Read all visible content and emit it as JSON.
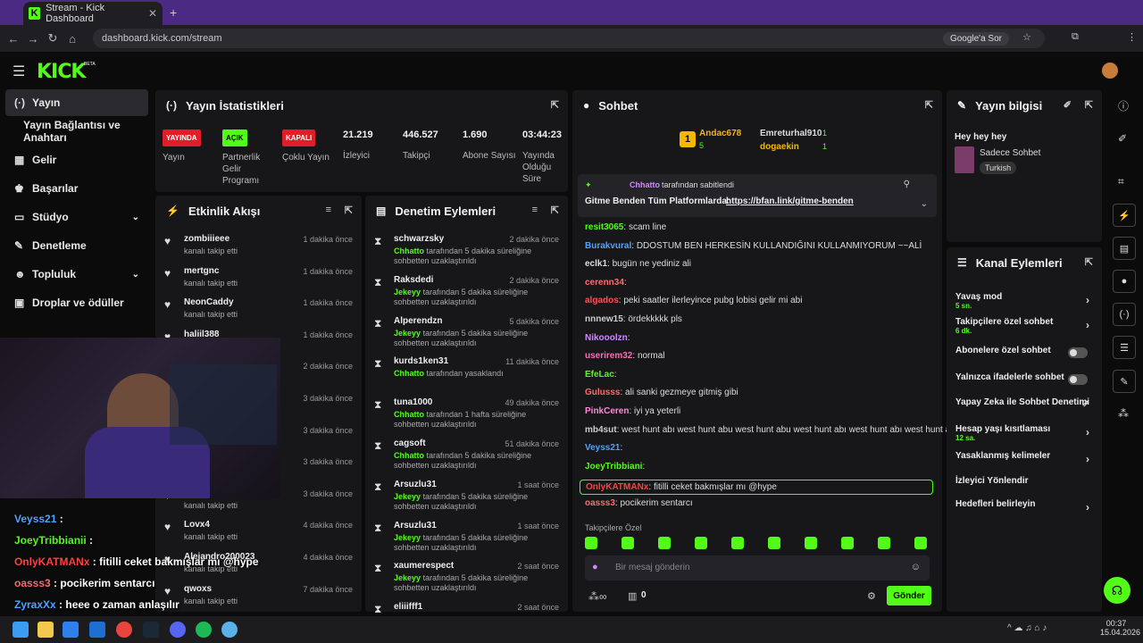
{
  "browser": {
    "tab_title": "Stream - Kick Dashboard",
    "url": "dashboard.kick.com/stream",
    "google_btn": "Google'a Sor"
  },
  "app": {
    "logo": "KICK",
    "beta": "BETA"
  },
  "sidebar": {
    "items": [
      {
        "label": "Yayın",
        "icon": "broadcast-icon"
      },
      {
        "label": "Yayın Bağlantısı ve Anahtarı"
      },
      {
        "label": "Gelir",
        "icon": "revenue-icon"
      },
      {
        "label": "Başarılar",
        "icon": "trophy-icon"
      },
      {
        "label": "Stüdyo",
        "icon": "studio-icon"
      },
      {
        "label": "Denetleme",
        "icon": "wrench-icon"
      },
      {
        "label": "Topluluk",
        "icon": "community-icon"
      },
      {
        "label": "Droplar ve ödüller",
        "icon": "gift-icon"
      }
    ]
  },
  "stats": {
    "title": "Yayın İstatistikleri",
    "items": [
      {
        "badge": "YAYINDA",
        "label": "Yayın",
        "color": "#e11d2a"
      },
      {
        "badge": "AÇIK",
        "label": "Partnerlik Gelir Programı",
        "color": "#53fc18"
      },
      {
        "badge": "KAPALI",
        "label": "Çoklu Yayın",
        "color": "#e11d2a"
      },
      {
        "value": "21.219",
        "label": "İzleyici"
      },
      {
        "value": "446.527",
        "label": "Takipçi"
      },
      {
        "value": "1.690",
        "label": "Abone Sayısı"
      },
      {
        "value": "03:44:23",
        "label": "Yayında Olduğu Süre"
      }
    ]
  },
  "activity": {
    "title": "Etkinlik Akışı",
    "items": [
      {
        "name": "zombiiieee",
        "sub": "kanalı takip etti",
        "time": "1 dakika önce"
      },
      {
        "name": "mertgnc",
        "sub": "kanalı takip etti",
        "time": "1 dakika önce"
      },
      {
        "name": "NeonCaddy",
        "sub": "kanalı takip etti",
        "time": "1 dakika önce"
      },
      {
        "name": "haliil388",
        "sub": "kanalı takip etti",
        "time": "1 dakika önce"
      },
      {
        "name": "",
        "sub": "",
        "time": "2 dakika önce"
      },
      {
        "name": "",
        "sub": "",
        "time": "3 dakika önce"
      },
      {
        "name": "",
        "sub": "",
        "time": "3 dakika önce"
      },
      {
        "name": "",
        "sub": "",
        "time": "3 dakika önce"
      },
      {
        "name": "",
        "sub": "kanalı takip etti",
        "time": "3 dakika önce"
      },
      {
        "name": "Lovx4",
        "sub": "kanalı takip etti",
        "time": "4 dakika önce"
      },
      {
        "name": "Alejandro200023",
        "sub": "kanalı takip etti",
        "time": "4 dakika önce"
      },
      {
        "name": "qwoxs",
        "sub": "kanalı takip etti",
        "time": "7 dakika önce"
      }
    ]
  },
  "moderation": {
    "title": "Denetim Eylemleri",
    "items": [
      {
        "name": "schwarzsky",
        "mod": "Chhatto",
        "sub": "tarafından 5 dakika süreliğine sohbetten uzaklaştırıldı",
        "time": "2 dakika önce"
      },
      {
        "name": "Raksdedi",
        "mod": "Jekeyy",
        "sub": "tarafından 5 dakika süreliğine sohbetten uzaklaştırıldı",
        "time": "2 dakika önce"
      },
      {
        "name": "Alperendzn",
        "mod": "Jekeyy",
        "sub": "tarafından 5 dakika süreliğine sohbetten uzaklaştırıldı",
        "time": "5 dakika önce"
      },
      {
        "name": "kurds1ken31",
        "mod": "Chhatto",
        "sub": "tarafından yasaklandı",
        "time": "11 dakika önce"
      },
      {
        "name": "tuna1000",
        "mod": "Chhatto",
        "sub": "tarafından 1 hafta süreliğine sohbetten uzaklaştırıldı",
        "time": "49 dakika önce"
      },
      {
        "name": "cagsoft",
        "mod": "Chhatto",
        "sub": "tarafından 5 dakika süreliğine sohbetten uzaklaştırıldı",
        "time": "51 dakika önce"
      },
      {
        "name": "Arsuzlu31",
        "mod": "Jekeyy",
        "sub": "tarafından 5 dakika süreliğine sohbetten uzaklaştırıldı",
        "time": "1 saat önce"
      },
      {
        "name": "Arsuzlu31",
        "mod": "Jekeyy",
        "sub": "tarafından 5 dakika süreliğine sohbetten uzaklaştırıldı",
        "time": "1 saat önce"
      },
      {
        "name": "xaumerespect",
        "mod": "Jekeyy",
        "sub": "tarafından 5 dakika süreliğine sohbetten uzaklaştırıldı",
        "time": "2 saat önce"
      },
      {
        "name": "eliiifff1",
        "mod": "",
        "sub": "",
        "time": "2 saat önce"
      }
    ]
  },
  "chat": {
    "title": "Sohbet",
    "leader": {
      "rank": "1",
      "name": "Andac678",
      "count": "5",
      "u2": "Emreturhal910",
      "c2": "1",
      "u3": "dogaekin",
      "c3": "1"
    },
    "pinned": {
      "by": "Chhatto",
      "label": "tarafından sabitlendi",
      "text": "Gitme Benden Tüm Platformlarda:",
      "link": "https://bfan.link/gitme-benden"
    },
    "messages": [
      {
        "user": "resit3065",
        "color": "#53fc18",
        "text": "scam line"
      },
      {
        "user": "Burakvural",
        "color": "#4fa3ff",
        "text": "DDOSTUM BEN HERKESİN KULLANDIĞINI KULLANMIYORUM ~~ALİ"
      },
      {
        "user": "eclk1",
        "color": "#ddd",
        "text": "bugün ne yediniz ali"
      },
      {
        "user": "cerenn34",
        "color": "#ff6b6b",
        "text": ""
      },
      {
        "user": "algados",
        "color": "#ff5252",
        "text": "peki saatler ilerleyince pubg lobisi gelir mi abi"
      },
      {
        "user": "nnnew15",
        "color": "#ccc",
        "text": "ördekkkkk pls"
      },
      {
        "user": "Nikooolzn",
        "color": "#d08aff",
        "text": ""
      },
      {
        "user": "userirem32",
        "color": "#ff6bb5",
        "text": "normal"
      },
      {
        "user": "EfeLac",
        "color": "#53fc18",
        "text": ""
      },
      {
        "user": "Gulusss",
        "color": "#ff6b6b",
        "text": "ali sanki gezmeye gitmiş gibi"
      },
      {
        "user": "PinkCeren",
        "color": "#ff8ad8",
        "text": "iyi ya yeterli"
      },
      {
        "user": "mb4sut",
        "color": "#ccc",
        "text": "west hunt abı west hunt abu west hunt abu west hunt abı west hunt abı west hunt abı"
      },
      {
        "user": "Veyss21",
        "color": "#4fa3ff",
        "text": ""
      },
      {
        "user": "JoeyTribbiani",
        "color": "#53fc18",
        "text": ""
      },
      {
        "user": "OnlyKATMANx",
        "color": "#ff4040",
        "text": "fitilli ceket bakmışlar mı @hype"
      },
      {
        "user": "oasss3",
        "color": "#ff6b6b",
        "text": "pocikerim sentarcı"
      }
    ],
    "followers_only": "Takipçilere Özel",
    "input_placeholder": "Bir mesaj gönderin",
    "points": "0",
    "send": "Gönder"
  },
  "stream_info": {
    "title": "Yayın bilgisi",
    "stream_title": "Hey hey hey",
    "category": "Sadece Sohbet",
    "tag": "Turkish"
  },
  "channel_actions": {
    "title": "Kanal Eylemleri",
    "items": [
      {
        "label": "Yavaş mod",
        "sub": "5 sn.",
        "type": "arrow"
      },
      {
        "label": "Takipçilere özel sohbet",
        "sub": "6 dk.",
        "type": "arrow"
      },
      {
        "label": "Abonelere özel sohbet",
        "sub": "",
        "type": "toggle"
      },
      {
        "label": "Yalnızca ifadelerle sohbet",
        "sub": "",
        "type": "toggle"
      },
      {
        "label": "Yapay Zeka ile Sohbet Denetimi",
        "sub": "",
        "type": "ext"
      },
      {
        "label": "Hesap yaşı kısıtlaması",
        "sub": "12 sa.",
        "type": "arrow"
      },
      {
        "label": "Yasaklanmış kelimeler",
        "sub": "",
        "type": "arrow"
      },
      {
        "label": "İzleyici Yönlendir",
        "sub": "",
        "type": "none"
      },
      {
        "label": "Hedefleri belirleyin",
        "sub": "",
        "type": "arrow"
      }
    ]
  },
  "overlay_chat": [
    {
      "user": "Veyss21",
      "color": "#4fa3ff",
      "text": " : "
    },
    {
      "user": "JoeyTribbianii",
      "color": "#53fc18",
      "text": " : "
    },
    {
      "user": "OnlyKATMANx",
      "color": "#ff4040",
      "text": " : fitilli ceket bakmışlar mı @hype"
    },
    {
      "user": "oasss3",
      "color": "#ff6b6b",
      "text": " : pocikerim sentarcı"
    },
    {
      "user": "ZyraxXx",
      "color": "#4fa3ff",
      "text": " : heee o zaman anlaşılır"
    }
  ],
  "taskbar": {
    "time": "00:37",
    "date": "15.04.2026"
  }
}
